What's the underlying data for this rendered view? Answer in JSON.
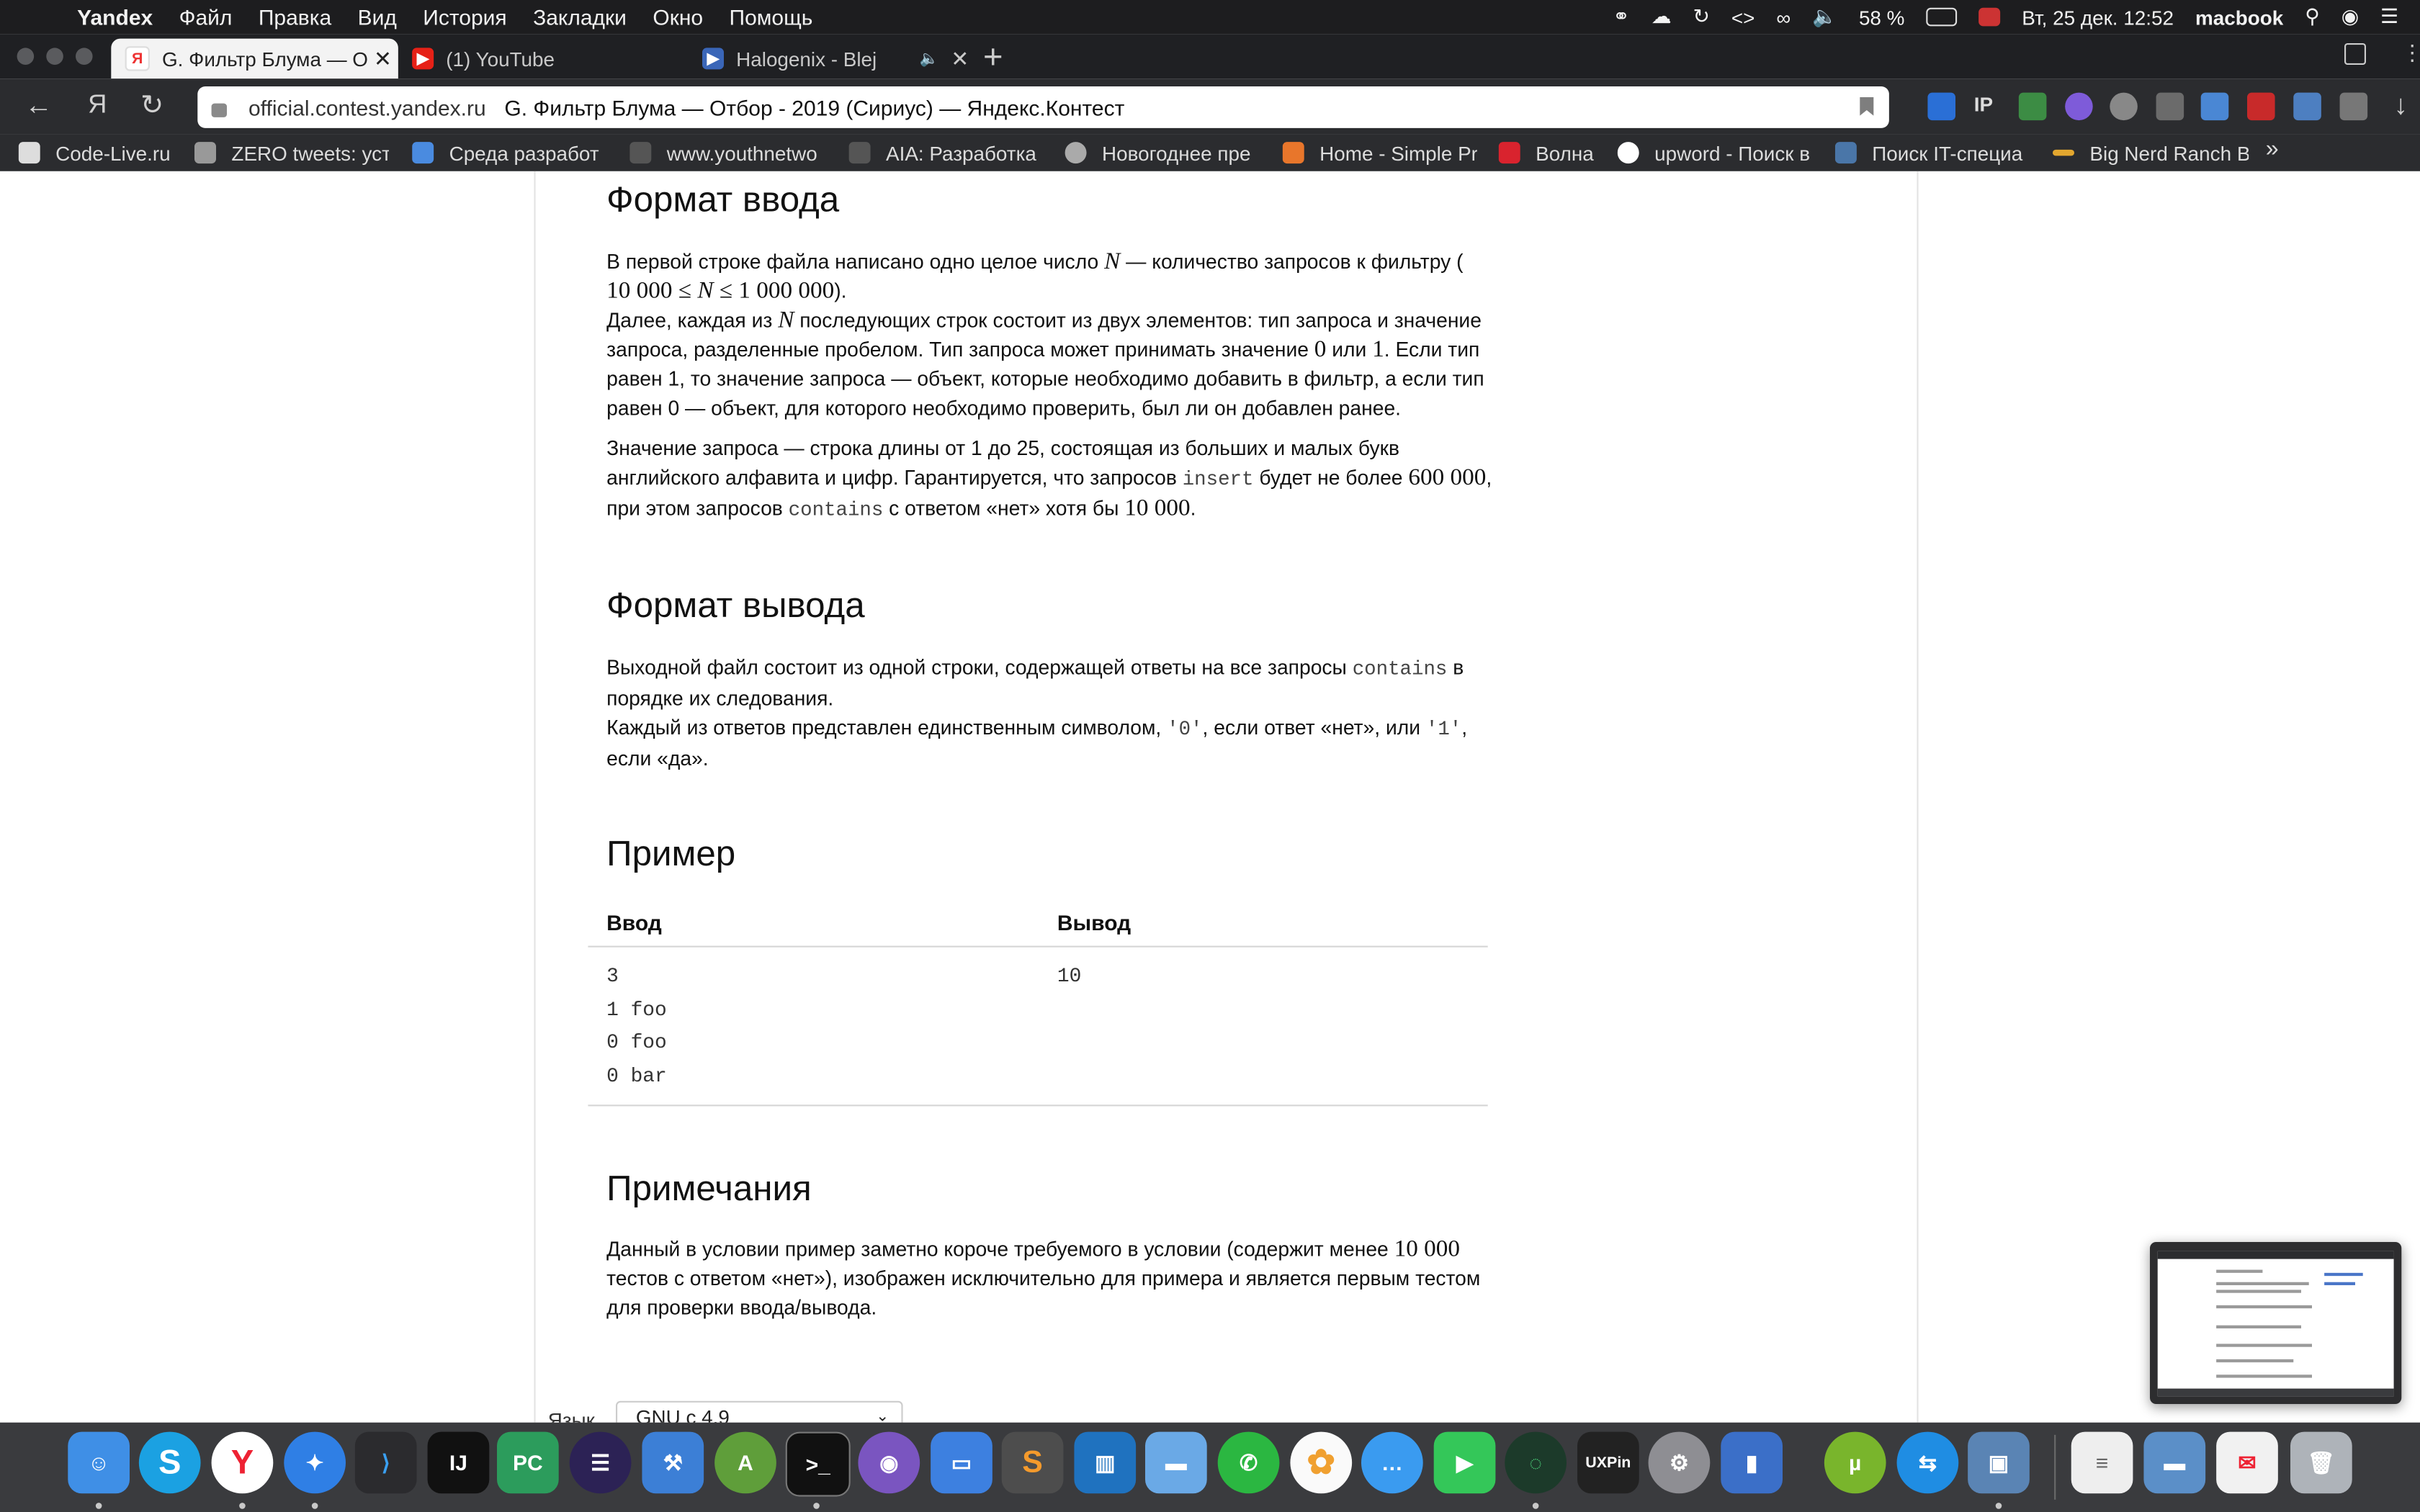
{
  "menubar": {
    "app": "Yandex",
    "items": [
      "Файл",
      "Правка",
      "Вид",
      "История",
      "Закладки",
      "Окно",
      "Помощь"
    ],
    "battery": "58 %",
    "datetime": "Вт, 25 дек. 12:52",
    "user": "macbook"
  },
  "tabs": [
    {
      "title": "G. Фильтр Блума — От",
      "favicon": "yandex-icon",
      "active": true
    },
    {
      "title": "(1) YouTube",
      "favicon": "youtube-icon",
      "active": false
    },
    {
      "title": "Halogenix - Blej",
      "favicon": "play-icon",
      "active": false
    }
  ],
  "omnibox": {
    "domain": "official.contest.yandex.ru",
    "page_title": "G. Фильтр Блума — Отбор - 2019 (Сириус) — Яндекс.Контест"
  },
  "bookmarks": [
    "Code-Live.ru",
    "ZERO tweets: уст",
    "Среда разработ",
    "www.youthnetwo",
    "AIA: Разработка",
    "Новогоднее пре",
    "Home - Simple Pr",
    "Волна",
    "upword - Поиск в",
    "Поиск IT-специа",
    "Big Nerd Ranch B"
  ],
  "content": {
    "input_heading": "Формат ввода",
    "input_p1": [
      "В первой строке файла написано одно целое число ",
      "N",
      " — количество запросов к фильтру ("
    ],
    "input_p1b": [
      "10 000 ≤ ",
      "N",
      " ≤ 1 000 000",
      ")."
    ],
    "input_p2": [
      "Далее, каждая из ",
      "N",
      " последующих строк состоит из двух элементов: тип запроса и значение запроса, разделенные пробелом. Тип запроса может принимать значение ",
      "0",
      " или ",
      "1",
      ". Если тип равен 1, то значение запроса — объект, которые необходимо добавить в фильтр, а если тип равен 0 — объект, для которого необходимо проверить, был ли он добавлен ранее."
    ],
    "input_p3": [
      "Значение запроса — строка длины от 1 до 25, состоящая из больших и малых букв английского алфавита и цифр. Гарантируется, что запросов ",
      "insert",
      " будет не более ",
      "600 000",
      ",",
      "при этом запросов ",
      "contains",
      " с ответом «нет» хотя бы ",
      "10 000",
      "."
    ],
    "output_heading": "Формат вывода",
    "output_p1": [
      "Выходной файл состоит из одной строки, содержащей ответы на все запросы ",
      "contains",
      " в порядке их следования."
    ],
    "output_p2": [
      "Каждый из ответов представлен единственным символом, ",
      "'0'",
      ", если ответ «нет», или ",
      "'1'",
      ", если «да»."
    ],
    "example_heading": "Пример",
    "example_input_label": "Ввод",
    "example_output_label": "Вывод",
    "example_input": "3\n1 foo\n0 foo\n0 bar",
    "example_output": "10",
    "notes_heading": "Примечания",
    "notes_p": [
      "Данный в условии пример заметно короче требуемого в условии (содержит менее ",
      "10 000",
      " тестов с ответом «нет»), изображен исключительно для примера и является первым тестом для проверки ввода/вывода."
    ],
    "lang_label": "Язык",
    "lang_value": "GNU c 4.9"
  },
  "dock": [
    "Finder",
    "Skype",
    "Yandex",
    "Safari",
    "VS Code",
    "IntelliJ IDEA",
    "PyCharm",
    "Eclipse",
    "Xcode",
    "Android Studio",
    "Terminal",
    "GitHub",
    "Keynote",
    "Sublime",
    "Trello",
    "Folder",
    "WhatsApp",
    "Photos",
    "Messages",
    "FaceTime",
    "Sync",
    "UXPin",
    "System Preferences",
    "Instruments",
    "uTorrent",
    "TeamViewer",
    "Preview",
    "Document",
    "Folder",
    "Mail",
    "Trash"
  ]
}
